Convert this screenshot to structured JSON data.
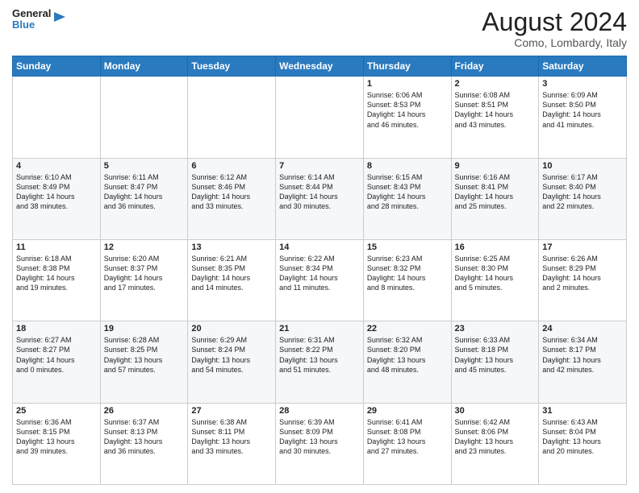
{
  "logo": {
    "line1": "General",
    "line2": "Blue"
  },
  "title": "August 2024",
  "subtitle": "Como, Lombardy, Italy",
  "days_of_week": [
    "Sunday",
    "Monday",
    "Tuesday",
    "Wednesday",
    "Thursday",
    "Friday",
    "Saturday"
  ],
  "weeks": [
    [
      {
        "day": "",
        "info": ""
      },
      {
        "day": "",
        "info": ""
      },
      {
        "day": "",
        "info": ""
      },
      {
        "day": "",
        "info": ""
      },
      {
        "day": "1",
        "info": "Sunrise: 6:06 AM\nSunset: 8:53 PM\nDaylight: 14 hours\nand 46 minutes."
      },
      {
        "day": "2",
        "info": "Sunrise: 6:08 AM\nSunset: 8:51 PM\nDaylight: 14 hours\nand 43 minutes."
      },
      {
        "day": "3",
        "info": "Sunrise: 6:09 AM\nSunset: 8:50 PM\nDaylight: 14 hours\nand 41 minutes."
      }
    ],
    [
      {
        "day": "4",
        "info": "Sunrise: 6:10 AM\nSunset: 8:49 PM\nDaylight: 14 hours\nand 38 minutes."
      },
      {
        "day": "5",
        "info": "Sunrise: 6:11 AM\nSunset: 8:47 PM\nDaylight: 14 hours\nand 36 minutes."
      },
      {
        "day": "6",
        "info": "Sunrise: 6:12 AM\nSunset: 8:46 PM\nDaylight: 14 hours\nand 33 minutes."
      },
      {
        "day": "7",
        "info": "Sunrise: 6:14 AM\nSunset: 8:44 PM\nDaylight: 14 hours\nand 30 minutes."
      },
      {
        "day": "8",
        "info": "Sunrise: 6:15 AM\nSunset: 8:43 PM\nDaylight: 14 hours\nand 28 minutes."
      },
      {
        "day": "9",
        "info": "Sunrise: 6:16 AM\nSunset: 8:41 PM\nDaylight: 14 hours\nand 25 minutes."
      },
      {
        "day": "10",
        "info": "Sunrise: 6:17 AM\nSunset: 8:40 PM\nDaylight: 14 hours\nand 22 minutes."
      }
    ],
    [
      {
        "day": "11",
        "info": "Sunrise: 6:18 AM\nSunset: 8:38 PM\nDaylight: 14 hours\nand 19 minutes."
      },
      {
        "day": "12",
        "info": "Sunrise: 6:20 AM\nSunset: 8:37 PM\nDaylight: 14 hours\nand 17 minutes."
      },
      {
        "day": "13",
        "info": "Sunrise: 6:21 AM\nSunset: 8:35 PM\nDaylight: 14 hours\nand 14 minutes."
      },
      {
        "day": "14",
        "info": "Sunrise: 6:22 AM\nSunset: 8:34 PM\nDaylight: 14 hours\nand 11 minutes."
      },
      {
        "day": "15",
        "info": "Sunrise: 6:23 AM\nSunset: 8:32 PM\nDaylight: 14 hours\nand 8 minutes."
      },
      {
        "day": "16",
        "info": "Sunrise: 6:25 AM\nSunset: 8:30 PM\nDaylight: 14 hours\nand 5 minutes."
      },
      {
        "day": "17",
        "info": "Sunrise: 6:26 AM\nSunset: 8:29 PM\nDaylight: 14 hours\nand 2 minutes."
      }
    ],
    [
      {
        "day": "18",
        "info": "Sunrise: 6:27 AM\nSunset: 8:27 PM\nDaylight: 14 hours\nand 0 minutes."
      },
      {
        "day": "19",
        "info": "Sunrise: 6:28 AM\nSunset: 8:25 PM\nDaylight: 13 hours\nand 57 minutes."
      },
      {
        "day": "20",
        "info": "Sunrise: 6:29 AM\nSunset: 8:24 PM\nDaylight: 13 hours\nand 54 minutes."
      },
      {
        "day": "21",
        "info": "Sunrise: 6:31 AM\nSunset: 8:22 PM\nDaylight: 13 hours\nand 51 minutes."
      },
      {
        "day": "22",
        "info": "Sunrise: 6:32 AM\nSunset: 8:20 PM\nDaylight: 13 hours\nand 48 minutes."
      },
      {
        "day": "23",
        "info": "Sunrise: 6:33 AM\nSunset: 8:18 PM\nDaylight: 13 hours\nand 45 minutes."
      },
      {
        "day": "24",
        "info": "Sunrise: 6:34 AM\nSunset: 8:17 PM\nDaylight: 13 hours\nand 42 minutes."
      }
    ],
    [
      {
        "day": "25",
        "info": "Sunrise: 6:36 AM\nSunset: 8:15 PM\nDaylight: 13 hours\nand 39 minutes."
      },
      {
        "day": "26",
        "info": "Sunrise: 6:37 AM\nSunset: 8:13 PM\nDaylight: 13 hours\nand 36 minutes."
      },
      {
        "day": "27",
        "info": "Sunrise: 6:38 AM\nSunset: 8:11 PM\nDaylight: 13 hours\nand 33 minutes."
      },
      {
        "day": "28",
        "info": "Sunrise: 6:39 AM\nSunset: 8:09 PM\nDaylight: 13 hours\nand 30 minutes."
      },
      {
        "day": "29",
        "info": "Sunrise: 6:41 AM\nSunset: 8:08 PM\nDaylight: 13 hours\nand 27 minutes."
      },
      {
        "day": "30",
        "info": "Sunrise: 6:42 AM\nSunset: 8:06 PM\nDaylight: 13 hours\nand 23 minutes."
      },
      {
        "day": "31",
        "info": "Sunrise: 6:43 AM\nSunset: 8:04 PM\nDaylight: 13 hours\nand 20 minutes."
      }
    ]
  ]
}
